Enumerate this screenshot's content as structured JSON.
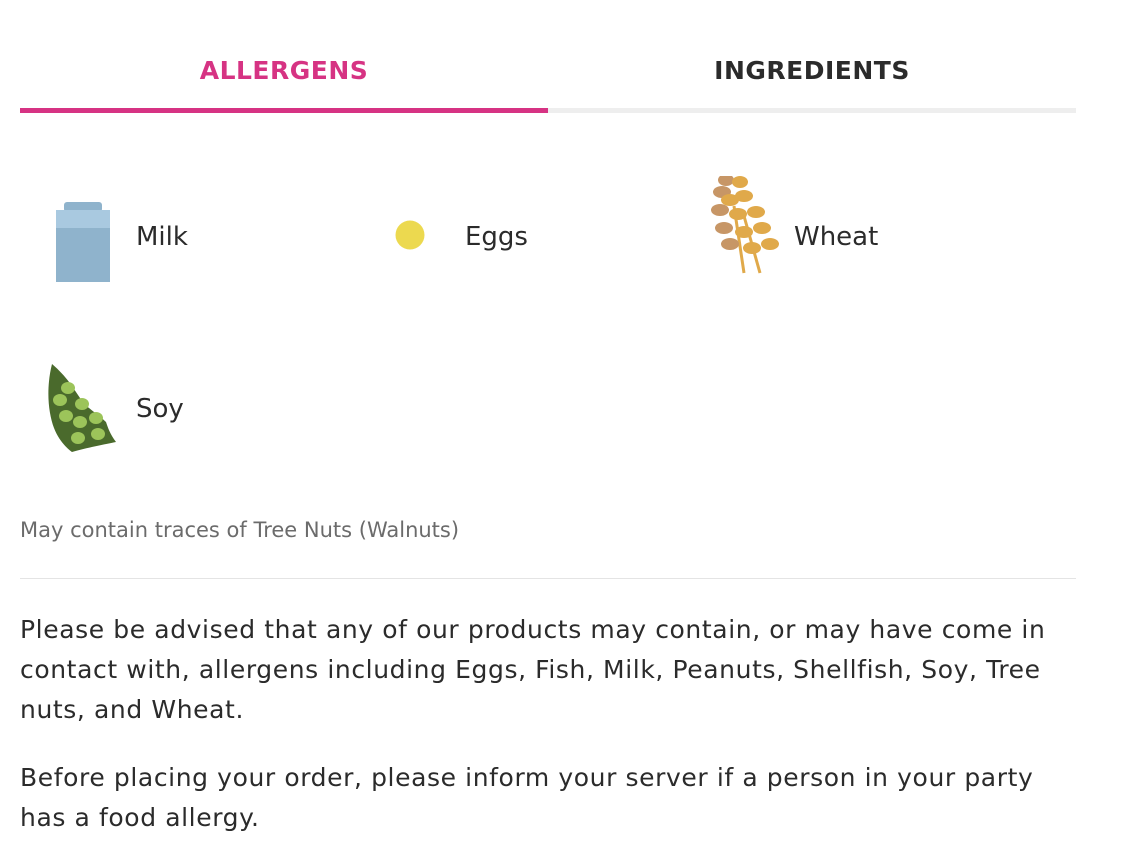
{
  "tabs": {
    "allergens": "ALLERGENS",
    "ingredients": "INGREDIENTS",
    "active": "allergens"
  },
  "allergens": [
    {
      "label": "Milk",
      "icon": "milk-carton-icon"
    },
    {
      "label": "Eggs",
      "icon": "egg-icon"
    },
    {
      "label": "Wheat",
      "icon": "wheat-icon"
    },
    {
      "label": "Soy",
      "icon": "soy-pod-icon"
    }
  ],
  "traces_note": "May contain traces of Tree Nuts (Walnuts)",
  "advisory": {
    "paragraph1": "Please be advised that any of our products may contain, or may have come in contact with, allergens including Eggs, Fish, Milk, Peanuts, Shellfish, Soy, Tree nuts, and Wheat.",
    "paragraph2": "Before placing your order, please inform your server if a person in your party has a food allergy."
  },
  "colors": {
    "accent": "#d63383",
    "text": "#2b2b2b",
    "muted": "#6b6b6b",
    "milk": "#8fb3cc",
    "egg": "#ecd94f",
    "wheat": "#e0a94a",
    "soy_pod": "#4a6a2c",
    "soy_bean": "#9cc45a"
  }
}
